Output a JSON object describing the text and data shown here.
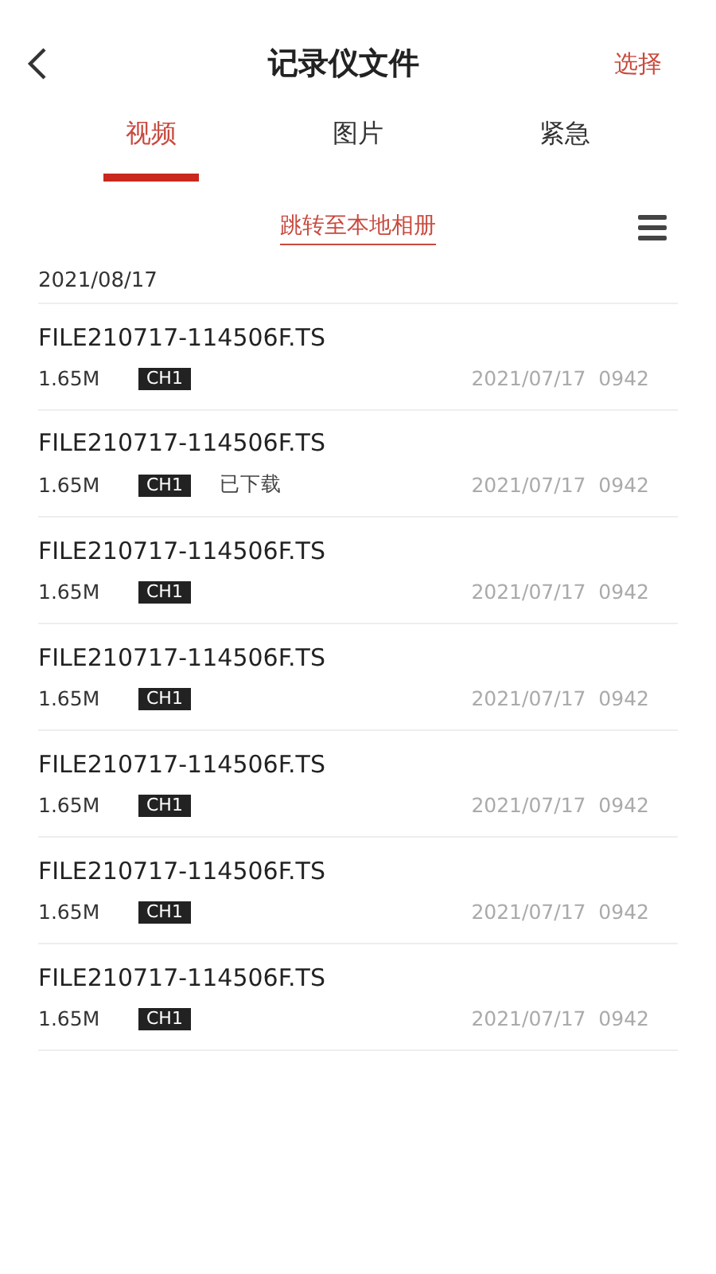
{
  "header": {
    "title": "记录仪文件",
    "action": "选择"
  },
  "tabs": [
    {
      "label": "视频",
      "selected": true
    },
    {
      "label": "图片",
      "selected": false
    },
    {
      "label": "紧急",
      "selected": false
    }
  ],
  "album_link": "跳转至本地相册",
  "date_group": "2021/08/17",
  "files": [
    {
      "name": "FILE210717-114506F.TS",
      "size": "1.65M",
      "channel": "CH1",
      "time": "2021/07/17  0942"
    },
    {
      "name": "FILE210717-114506F.TS",
      "size": "1.65M",
      "channel": "CH1",
      "status": "已下载",
      "time": "2021/07/17  0942"
    },
    {
      "name": "FILE210717-114506F.TS",
      "size": "1.65M",
      "channel": "CH1",
      "time": "2021/07/17  0942"
    },
    {
      "name": "FILE210717-114506F.TS",
      "size": "1.65M",
      "channel": "CH1",
      "time": "2021/07/17  0942"
    },
    {
      "name": "FILE210717-114506F.TS",
      "size": "1.65M",
      "channel": "CH1",
      "time": "2021/07/17  0942"
    },
    {
      "name": "FILE210717-114506F.TS",
      "size": "1.65M",
      "channel": "CH1",
      "time": "2021/07/17  0942"
    },
    {
      "name": "FILE210717-114506F.TS",
      "size": "1.65M",
      "channel": "CH1",
      "time": "2021/07/17  0942"
    }
  ]
}
